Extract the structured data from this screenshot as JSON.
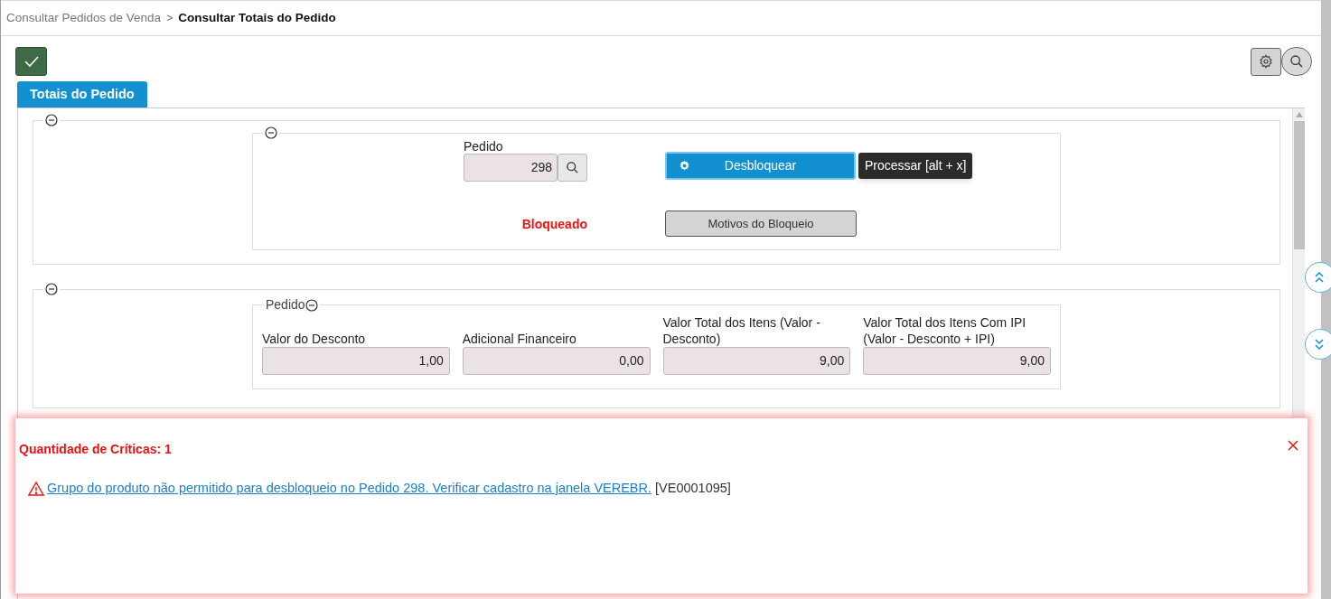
{
  "breadcrumb": [
    {
      "label": "Consultar Pedidos de Venda",
      "current": false
    },
    {
      "label": "Consultar Totais do Pedido",
      "current": true
    }
  ],
  "breadcrumb_separator": ">",
  "tabs": [
    {
      "label": "Totais do Pedido",
      "selected": true
    }
  ],
  "order_section": {
    "field_label": "Pedido",
    "value": "298",
    "status": "Bloqueado",
    "primary_button": "Desbloquear",
    "tooltip": "Processar [alt + x]",
    "secondary_button": "Motivos do Bloqueio"
  },
  "totals_section": {
    "legend": "Pedido",
    "fields": [
      {
        "label": "Valor do Desconto",
        "value": "1,00"
      },
      {
        "label": "Adicional Financeiro",
        "value": "0,00"
      },
      {
        "label": "Valor Total dos Itens (Valor - Desconto)",
        "value": "9,00"
      },
      {
        "label": "Valor Total dos Itens Com IPI (Valor - Desconto + IPI)",
        "value": "9,00"
      }
    ]
  },
  "criticisms": {
    "title": "Quantidade de Críticas: 1",
    "messages": [
      {
        "text": "Grupo do produto não permitido para desbloqueio no Pedido 298. Verificar cadastro na janela VEREBR.",
        "code": "[VE0001095]"
      }
    ]
  }
}
